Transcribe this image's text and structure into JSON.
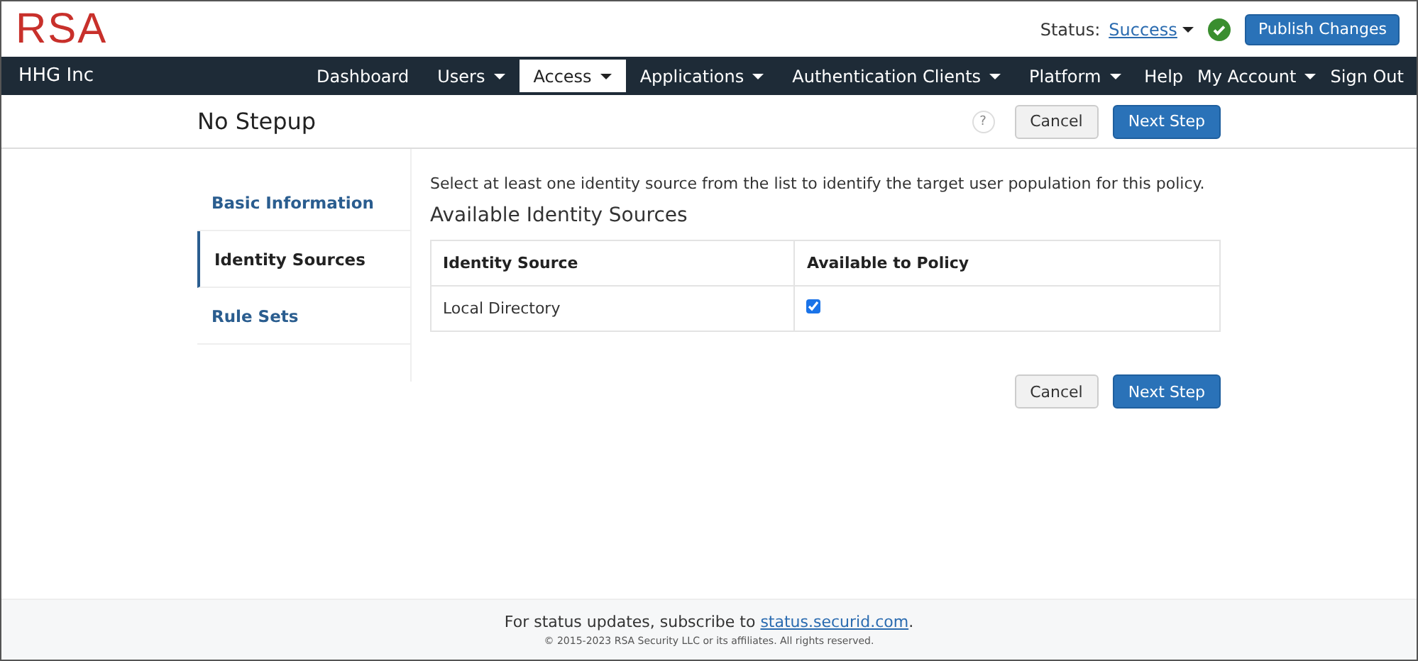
{
  "logo": "RSA",
  "status": {
    "label": "Status:",
    "value": "Success",
    "ok": true
  },
  "publish_button": "Publish Changes",
  "navbar": {
    "brand": "HHG Inc",
    "items": [
      {
        "label": "Dashboard",
        "dropdown": false,
        "selected": false
      },
      {
        "label": "Users",
        "dropdown": true,
        "selected": false
      },
      {
        "label": "Access",
        "dropdown": true,
        "selected": true
      },
      {
        "label": "Applications",
        "dropdown": true,
        "selected": false
      },
      {
        "label": "Authentication Clients",
        "dropdown": true,
        "selected": false
      },
      {
        "label": "Platform",
        "dropdown": true,
        "selected": false
      }
    ],
    "right_items": [
      {
        "label": "Help",
        "dropdown": false
      },
      {
        "label": "My Account",
        "dropdown": true
      },
      {
        "label": "Sign Out",
        "dropdown": false
      }
    ]
  },
  "page_title": "No Stepup",
  "help_icon": "?",
  "top_buttons": [
    "Cancel",
    "Next Step"
  ],
  "steps": [
    {
      "label": "Basic Information",
      "selected": false
    },
    {
      "label": "Identity Sources",
      "selected": true
    },
    {
      "label": "Rule Sets",
      "selected": false
    }
  ],
  "instructions": "Select at least one identity source from the list to identify the target user population for this policy.",
  "section_title": "Available Identity Sources",
  "table": {
    "columns": [
      "Identity Source",
      "Available to Policy"
    ],
    "rows": [
      {
        "name": "Local Directory",
        "checked": true
      }
    ]
  },
  "bottom_buttons": [
    "Cancel",
    "Next Step"
  ],
  "footer": {
    "prefix": "For status updates, subscribe to ",
    "link": "status.securid.com",
    "suffix": ".",
    "copyright": "© 2015-2023 RSA Security LLC or its affiliates. All rights reserved."
  }
}
